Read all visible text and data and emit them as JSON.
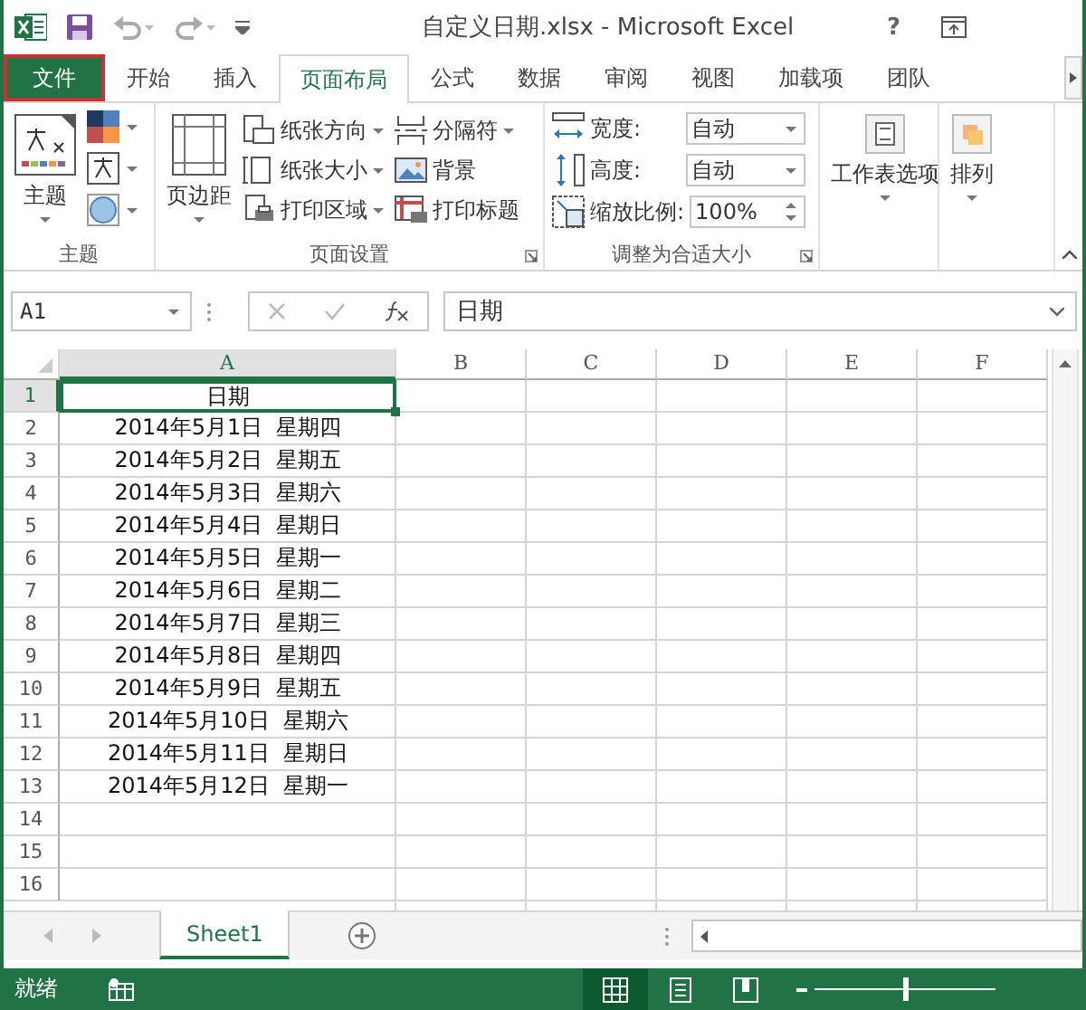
{
  "title_bar": {
    "document_title": "自定义日期.xlsx - Microsoft Excel",
    "help": "?"
  },
  "tabs": [
    {
      "label": "文件",
      "kind": "file",
      "selected": false
    },
    {
      "label": "开始",
      "kind": "tab",
      "selected": false
    },
    {
      "label": "插入",
      "kind": "tab",
      "selected": false
    },
    {
      "label": "页面布局",
      "kind": "tab",
      "selected": true
    },
    {
      "label": "公式",
      "kind": "tab",
      "selected": false
    },
    {
      "label": "数据",
      "kind": "tab",
      "selected": false
    },
    {
      "label": "审阅",
      "kind": "tab",
      "selected": false
    },
    {
      "label": "视图",
      "kind": "tab",
      "selected": false
    },
    {
      "label": "加载项",
      "kind": "tab",
      "selected": false
    },
    {
      "label": "团队",
      "kind": "tab",
      "selected": false
    }
  ],
  "ribbon": {
    "theme_group": {
      "label": "主题",
      "button": "主题"
    },
    "page_setup": {
      "label": "页面设置",
      "big_button": "页边距",
      "buttons": [
        {
          "label": "纸张方向",
          "dropdown": true
        },
        {
          "label": "纸张大小",
          "dropdown": true
        },
        {
          "label": "打印区域",
          "dropdown": true
        },
        {
          "label": "分隔符",
          "dropdown": true
        },
        {
          "label": "背景",
          "dropdown": false
        },
        {
          "label": "打印标题",
          "dropdown": false
        }
      ]
    },
    "scale_group": {
      "label": "调整为合适大小",
      "fields": [
        {
          "label": "宽度:",
          "value": "自动",
          "kind": "dropdown"
        },
        {
          "label": "高度:",
          "value": "自动",
          "kind": "dropdown"
        },
        {
          "label": "缩放比例:",
          "value": "100%",
          "kind": "spinner"
        }
      ]
    },
    "sheet_options": {
      "button": "工作表选项"
    },
    "arrange": {
      "button": "排列"
    }
  },
  "formula_bar": {
    "name_box": "A1",
    "formula": "日期"
  },
  "sheet": {
    "columns": [
      {
        "label": "A",
        "selected": true
      },
      {
        "label": "B",
        "selected": false
      },
      {
        "label": "C",
        "selected": false
      },
      {
        "label": "D",
        "selected": false
      },
      {
        "label": "E",
        "selected": false
      },
      {
        "label": "F",
        "selected": false
      }
    ],
    "rows": [
      {
        "number": "1",
        "selected": true,
        "value": "日期"
      },
      {
        "number": "2",
        "selected": false,
        "value": "2014年5月1日  星期四"
      },
      {
        "number": "3",
        "selected": false,
        "value": "2014年5月2日  星期五"
      },
      {
        "number": "4",
        "selected": false,
        "value": "2014年5月3日  星期六"
      },
      {
        "number": "5",
        "selected": false,
        "value": "2014年5月4日  星期日"
      },
      {
        "number": "6",
        "selected": false,
        "value": "2014年5月5日  星期一"
      },
      {
        "number": "7",
        "selected": false,
        "value": "2014年5月6日  星期二"
      },
      {
        "number": "8",
        "selected": false,
        "value": "2014年5月7日  星期三"
      },
      {
        "number": "9",
        "selected": false,
        "value": "2014年5月8日  星期四"
      },
      {
        "number": "10",
        "selected": false,
        "value": "2014年5月9日  星期五"
      },
      {
        "number": "11",
        "selected": false,
        "value": "2014年5月10日  星期六"
      },
      {
        "number": "12",
        "selected": false,
        "value": "2014年5月11日  星期日"
      },
      {
        "number": "13",
        "selected": false,
        "value": "2014年5月12日  星期一"
      },
      {
        "number": "14",
        "selected": false
      },
      {
        "number": "15",
        "selected": false
      },
      {
        "number": "16",
        "selected": false
      }
    ]
  },
  "sheet_tabs": [
    {
      "label": "Sheet1",
      "selected": true
    }
  ],
  "status_bar": {
    "status": "就绪",
    "views": [
      {
        "kind": "normal",
        "selected": true
      },
      {
        "kind": "page_layout",
        "selected": false
      },
      {
        "kind": "page_break",
        "selected": false
      }
    ],
    "zoom": {
      "level": 0.5
    }
  }
}
